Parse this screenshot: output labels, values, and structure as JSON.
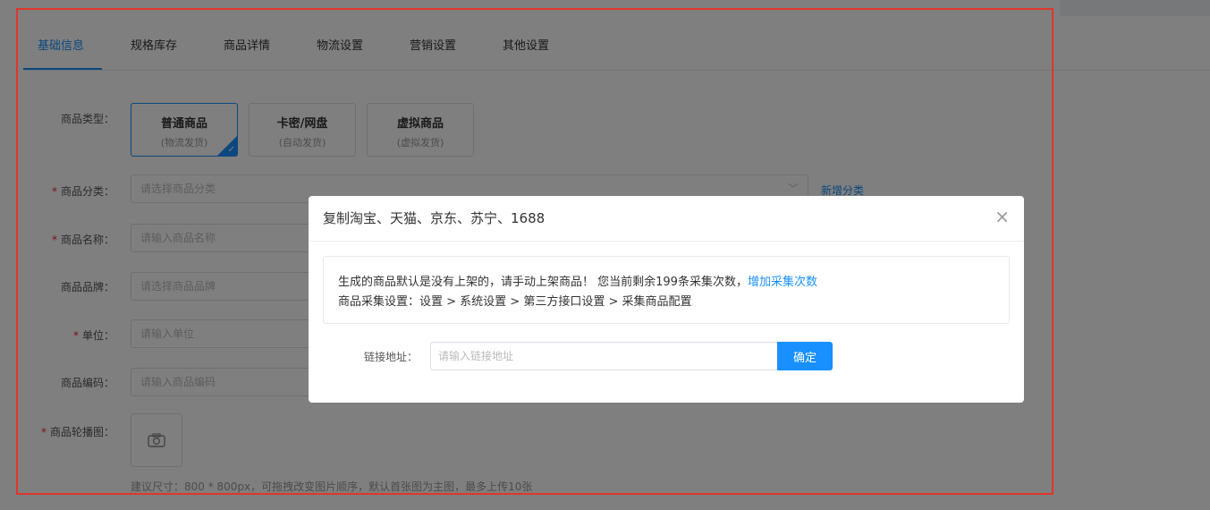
{
  "tabs": [
    {
      "label": "基础信息",
      "active": true
    },
    {
      "label": "规格库存"
    },
    {
      "label": "商品详情"
    },
    {
      "label": "物流设置"
    },
    {
      "label": "营销设置"
    },
    {
      "label": "其他设置"
    }
  ],
  "form": {
    "product_type_label": "商品类型：",
    "product_types": [
      {
        "title": "普通商品",
        "sub": "(物流发货)",
        "selected": true
      },
      {
        "title": "卡密/网盘",
        "sub": "(自动发货)"
      },
      {
        "title": "虚拟商品",
        "sub": "(虚拟发货)"
      }
    ],
    "category_label": "商品分类：",
    "category_placeholder": "请选择商品分类",
    "add_category": "新增分类",
    "name_label": "商品名称：",
    "name_placeholder": "请输入商品名称",
    "brand_label": "商品品牌：",
    "brand_placeholder": "请选择商品品牌",
    "unit_label": "单位：",
    "unit_placeholder": "请输入单位",
    "code_label": "商品编码：",
    "code_placeholder": "请输入商品编码",
    "carousel_label": "商品轮播图：",
    "carousel_hint": "建议尺寸：800 * 800px，可拖拽改变图片顺序，默认首张图为主图，最多上传10张",
    "required_mark": "*"
  },
  "modal": {
    "title": "复制淘宝、天猫、京东、苏宁、1688",
    "close": "×",
    "notice_line1": "生成的商品默认是没有上架的，请手动上架商品！ 您当前剩余199条采集次数，",
    "notice_link": "增加采集次数",
    "notice_line2": "商品采集设置：设置 > 系统设置 > 第三方接口设置 > 采集商品配置",
    "url_label": "链接地址：",
    "url_placeholder": "请输入链接地址",
    "confirm": "确定"
  },
  "colors": {
    "accent": "#1890ff",
    "highlight_border": "#e0352b",
    "required": "#f5222d"
  }
}
